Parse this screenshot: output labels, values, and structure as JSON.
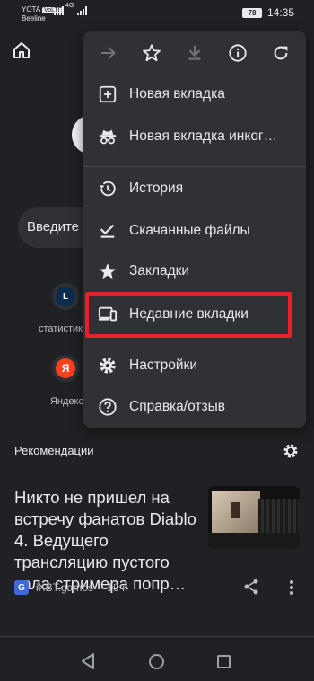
{
  "status_bar": {
    "carrier_top": "YOTA",
    "carrier_top_badge": "VoLTE",
    "carrier_bottom": "Beeline",
    "network": "4G",
    "battery": "78",
    "time": "14:35"
  },
  "background": {
    "search_placeholder": "Введите",
    "tiles": [
      {
        "letter": "L",
        "label": "статистик"
      },
      {
        "letter": "Я",
        "label": "Яндекс"
      }
    ],
    "recommendations_title": "Рекомендации",
    "article": {
      "title": "Никто не пришел на встречу фанатов Diablo 4. Ведущего трансляцию пустого зала стримера попр…",
      "source_icon_letter": "G",
      "source": "iXBT.games",
      "time": "· 19ч."
    }
  },
  "menu": {
    "toolbar": [
      {
        "icon": "forward-arrow-icon",
        "enabled": false
      },
      {
        "icon": "star-icon",
        "enabled": true
      },
      {
        "icon": "download-icon",
        "enabled": false
      },
      {
        "icon": "info-icon",
        "enabled": true
      },
      {
        "icon": "refresh-icon",
        "enabled": true
      }
    ],
    "items": [
      {
        "label": "Новая вкладка",
        "icon": "plus-box-icon"
      },
      {
        "label": "Новая вкладка инког…",
        "icon": "incognito-icon"
      },
      {
        "label": "История",
        "icon": "history-icon"
      },
      {
        "label": "Скачанные файлы",
        "icon": "downloads-check-icon"
      },
      {
        "label": "Закладки",
        "icon": "star-icon"
      },
      {
        "label": "Недавние вкладки",
        "icon": "devices-icon"
      },
      {
        "label": "Настройки",
        "icon": "gear-icon"
      },
      {
        "label": "Справка/отзыв",
        "icon": "help-icon"
      }
    ]
  },
  "colors": {
    "background": "#202124",
    "menu": "#303134",
    "highlight": "#e8202c",
    "text": "#e8eaed"
  }
}
